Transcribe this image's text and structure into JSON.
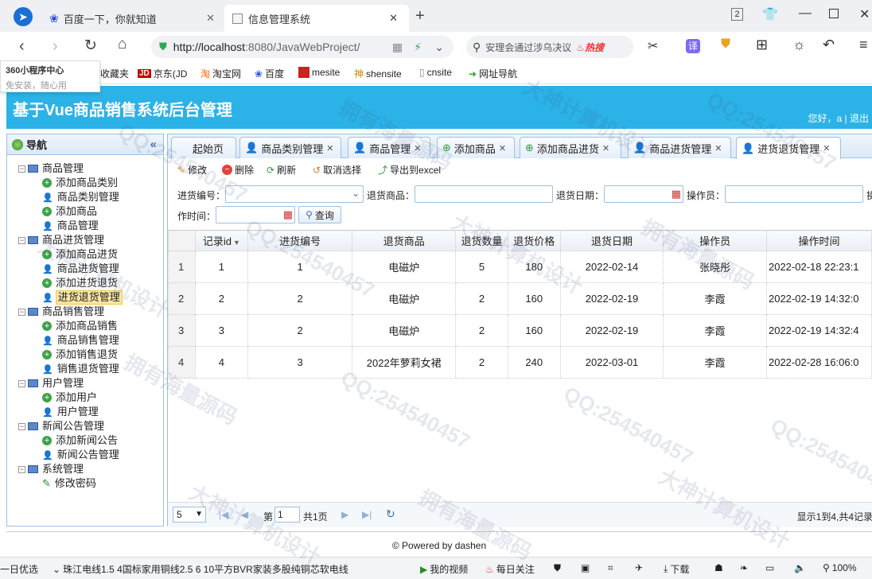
{
  "browser": {
    "tabs": [
      {
        "label": "百度一下，你就知道"
      },
      {
        "label": "信息管理系统"
      }
    ],
    "new_tab": "+",
    "tab_counter": "2",
    "url_host": "http://localhost",
    "url_rest": ":8080/JavaWebProject/",
    "search_text": "安理会通过涉乌决议",
    "search_badge": "热搜",
    "translate": "译",
    "popup_title": "360小程序中心",
    "popup_sub": "免安装，随心用",
    "bookmarks": [
      "收藏夹",
      "京东(JD",
      "淘宝网",
      "百度",
      "mesite",
      "shensite",
      "cnsite",
      "网址导航"
    ]
  },
  "header": {
    "title": "基于Vue商品销售系统后台管理",
    "greeting": "您好，a",
    "sep": "|",
    "logout": "退出"
  },
  "sidebar": {
    "title": "导航",
    "groups": [
      {
        "label": "商品管理",
        "items": [
          "添加商品类别",
          "商品类别管理",
          "添加商品",
          "商品管理"
        ]
      },
      {
        "label": "商品进货管理",
        "items": [
          "添加商品进货",
          "商品进货管理",
          "添加进货退货",
          "进货退货管理"
        ]
      },
      {
        "label": "商品销售管理",
        "items": [
          "添加商品销售",
          "商品销售管理",
          "添加销售退货",
          "销售退货管理"
        ]
      },
      {
        "label": "用户管理",
        "items": [
          "添加用户",
          "用户管理"
        ]
      },
      {
        "label": "新闻公告管理",
        "items": [
          "添加新闻公告",
          "新闻公告管理"
        ]
      },
      {
        "label": "系统管理",
        "items": [
          "修改密码"
        ]
      }
    ]
  },
  "tabs": [
    "起始页",
    "商品类别管理",
    "商品管理",
    "添加商品",
    "添加商品进货",
    "商品进货管理",
    "进货退货管理"
  ],
  "toolbar": {
    "edit": "修改",
    "delete": "删除",
    "refresh": "刷新",
    "cancel": "取消选择",
    "export": "导出到excel"
  },
  "filters": {
    "purchase_no": "进货编号：",
    "goods": "退货商品：",
    "date": "退货日期：",
    "operator": "操作员：",
    "op_time": "作时间：",
    "query": "查询",
    "cut_label": "操"
  },
  "table": {
    "columns": [
      "记录id",
      "进货编号",
      "退货商品",
      "退货数量",
      "退货价格",
      "退货日期",
      "操作员",
      "操作时间"
    ],
    "rows": [
      {
        "rn": "1",
        "id": "1",
        "purchase": "1",
        "goods": "电磁炉",
        "qty": "5",
        "price": "180",
        "date": "2022-02-14",
        "op": "张晓彤",
        "time": "2022-02-18 22:23:1"
      },
      {
        "rn": "2",
        "id": "2",
        "purchase": "2",
        "goods": "电磁炉",
        "qty": "2",
        "price": "160",
        "date": "2022-02-19",
        "op": "李霞",
        "time": "2022-02-19 14:32:0"
      },
      {
        "rn": "3",
        "id": "3",
        "purchase": "2",
        "goods": "电磁炉",
        "qty": "2",
        "price": "160",
        "date": "2022-02-19",
        "op": "李霞",
        "time": "2022-02-19 14:32:4"
      },
      {
        "rn": "4",
        "id": "4",
        "purchase": "3",
        "goods": "2022年萝莉女裙",
        "qty": "2",
        "price": "240",
        "date": "2022-03-01",
        "op": "李霞",
        "time": "2022-02-28 16:06:0"
      }
    ]
  },
  "pager": {
    "page_size": "5",
    "page_prefix": "第",
    "page_value": "1",
    "page_suffix": "共1页",
    "info": "显示1到4,共4记录"
  },
  "footer": "© Powered by dashen",
  "statusbar": {
    "left": "一日优选",
    "news": "珠江电线1.5 4国标家用铜线2.5 6 10平方BVR家装多股纯铜芯软电线",
    "video": "我的视频",
    "follow": "每日关注",
    "download": "下载",
    "zoom": "100%"
  },
  "watermarks": [
    "QQ:254540457",
    "大神计算机设计",
    "拥有海量源码"
  ]
}
